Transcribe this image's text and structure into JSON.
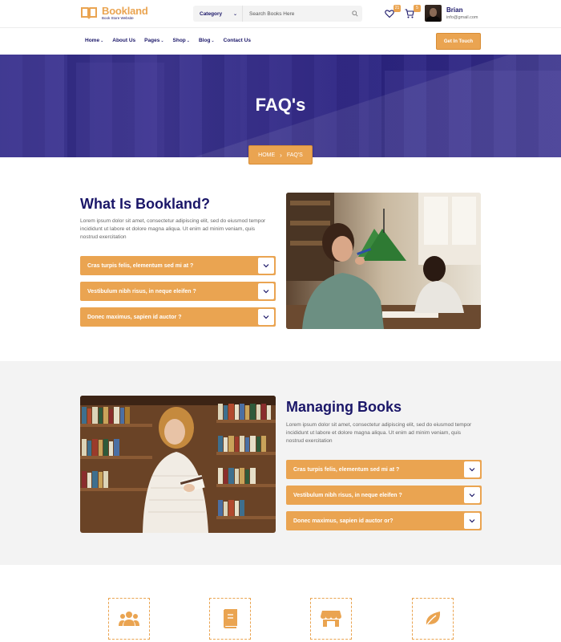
{
  "brand": {
    "name_part1": "Book",
    "name_part2": "land",
    "tagline": "Book Store Website"
  },
  "search": {
    "category_label": "Category",
    "placeholder": "Search Books Here"
  },
  "header": {
    "wishlist_count": "21",
    "cart_count": "5",
    "user_name": "Brian",
    "user_email": "info@gmail.com"
  },
  "nav": {
    "items": [
      {
        "label": "Home",
        "has_dropdown": true
      },
      {
        "label": "About Us",
        "has_dropdown": false
      },
      {
        "label": "Pages",
        "has_dropdown": true
      },
      {
        "label": "Shop",
        "has_dropdown": true
      },
      {
        "label": "Blog",
        "has_dropdown": true
      },
      {
        "label": "Contact Us",
        "has_dropdown": false
      }
    ],
    "cta_label": "Get In Touch"
  },
  "hero": {
    "title": "FAQ's",
    "breadcrumb_home": "HOME",
    "breadcrumb_current": "FAQ'S"
  },
  "section1": {
    "title": "What Is Bookland?",
    "text": "Lorem ipsum dolor sit amet, consectetur adipiscing elit, sed do eiusmod tempor incididunt ut labore et dolore magna aliqua. Ut enim ad minim veniam, quis nostrud exercitation",
    "faqs": [
      "Cras turpis felis, elementum sed mi at ?",
      "Vestibulum nibh risus, in neque eleifen ?",
      "Donec maximus, sapien id auctor ?"
    ]
  },
  "section2": {
    "title": "Managing Books",
    "text": "Lorem ipsum dolor sit amet, consectetur adipiscing elit, sed do eiusmod tempor incididunt ut labore et dolore magna aliqua. Ut enim ad minim veniam, quis nostrud exercitation",
    "faqs": [
      "Cras turpis felis, elementum sed mi at ?",
      "Vestibulum nibh risus, in neque eleifen ?",
      "Donec maximus, sapien id auctor or?"
    ]
  },
  "features": {
    "icons": [
      "users-icon",
      "book-icon",
      "store-icon",
      "leaf-icon"
    ]
  },
  "colors": {
    "accent": "#eaa451",
    "primary": "#1a1668",
    "hero_bg": "#2c2485",
    "section_grey": "#f3f3f3"
  }
}
